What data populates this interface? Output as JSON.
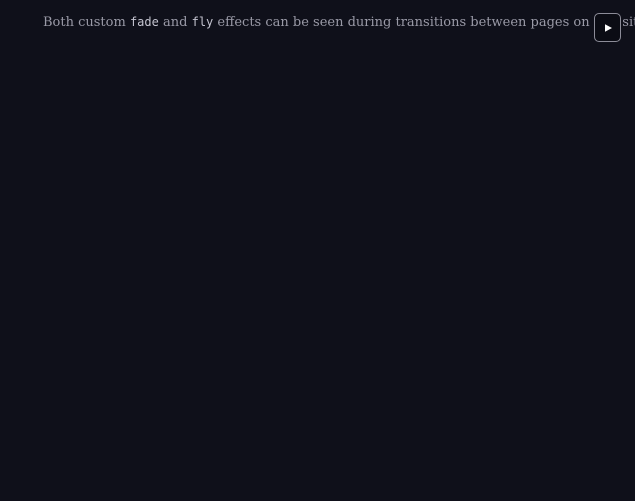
{
  "description": {
    "prefix": "Both custom",
    "code1": "fade",
    "mid": "and",
    "code2": "fly",
    "suffix": "effects can be seen during transitions between pages on this site."
  },
  "controls": {
    "play_icon": "play-icon"
  },
  "colors": {
    "background": "#0f101a",
    "text": "#9a9aa7",
    "code_text": "#c4c4d0",
    "button_border": "#8c8c98",
    "icon": "#ffffff"
  }
}
